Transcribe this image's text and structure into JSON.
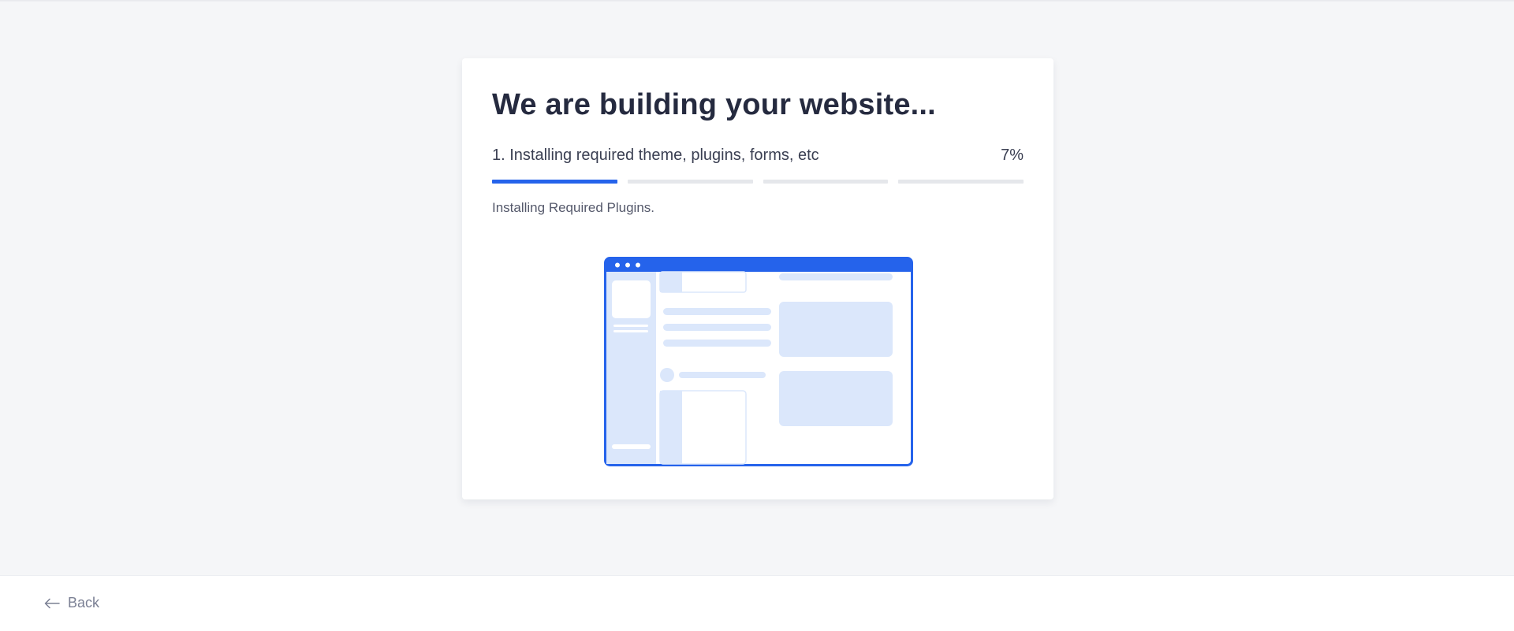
{
  "header": {
    "title": "We are building your website..."
  },
  "progress": {
    "step_label": "1. Installing required theme, plugins, forms, etc",
    "percent_label": "7%",
    "segments": [
      {
        "fill_fraction": 1.0
      },
      {
        "fill_fraction": 0.0
      },
      {
        "fill_fraction": 0.0
      },
      {
        "fill_fraction": 0.0
      }
    ],
    "status_text": "Installing Required Plugins."
  },
  "footer": {
    "back_label": "Back",
    "back_icon": "arrow-left-icon"
  },
  "colors": {
    "accent": "#2563eb",
    "track": "#e5e7eb",
    "illustration_fill": "#dbe7fb",
    "background": "#f5f6f8"
  }
}
